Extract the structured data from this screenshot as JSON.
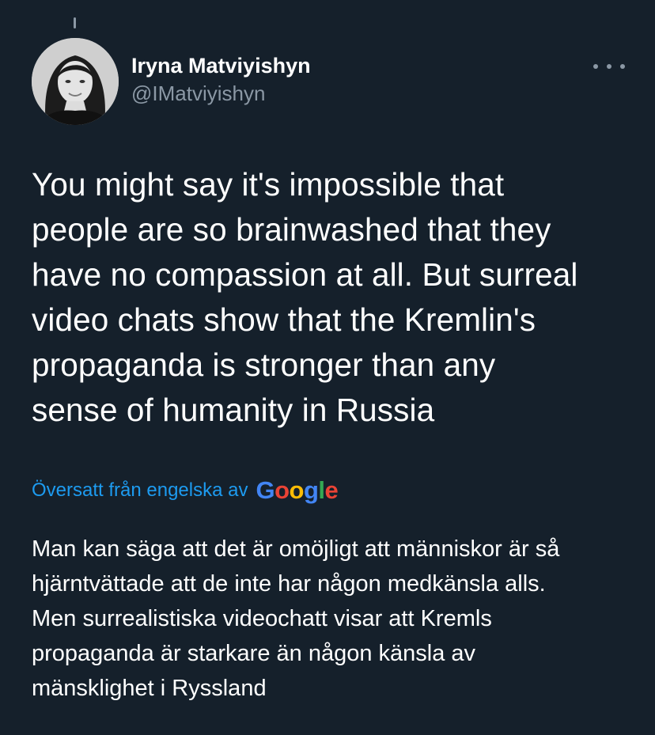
{
  "author": {
    "display_name": "Iryna Matviyishyn",
    "handle": "@IMatviyishyn"
  },
  "icons": {
    "more": "more-horizontal-icon",
    "avatar": "profile-photo"
  },
  "tweet": {
    "text": "You might say it's impossible that\npeople are so brainwashed that they\nhave no compassion at all. But surreal\nvideo chats show that the Kremlin's\npropaganda is stronger than any\nsense of humanity in Russia"
  },
  "translation": {
    "label": "Översatt från engelska av",
    "provider": {
      "letters": [
        "G",
        "o",
        "o",
        "g",
        "l",
        "e"
      ],
      "colors": [
        "#4285f4",
        "#ea4335",
        "#fbbc05",
        "#4285f4",
        "#34a853",
        "#ea4335"
      ]
    },
    "text": "Man kan säga att det är omöjligt att människor är så\nhjärntvättade att de inte har någon medkänsla alls.\nMen surrealistiska videochatt visar att Kremls\npropaganda är starkare än någon känsla av\nmänsklighet i Ryssland"
  },
  "colors": {
    "background": "#15202b",
    "secondary_text": "#8b98a5",
    "link": "#1d9bf0"
  }
}
